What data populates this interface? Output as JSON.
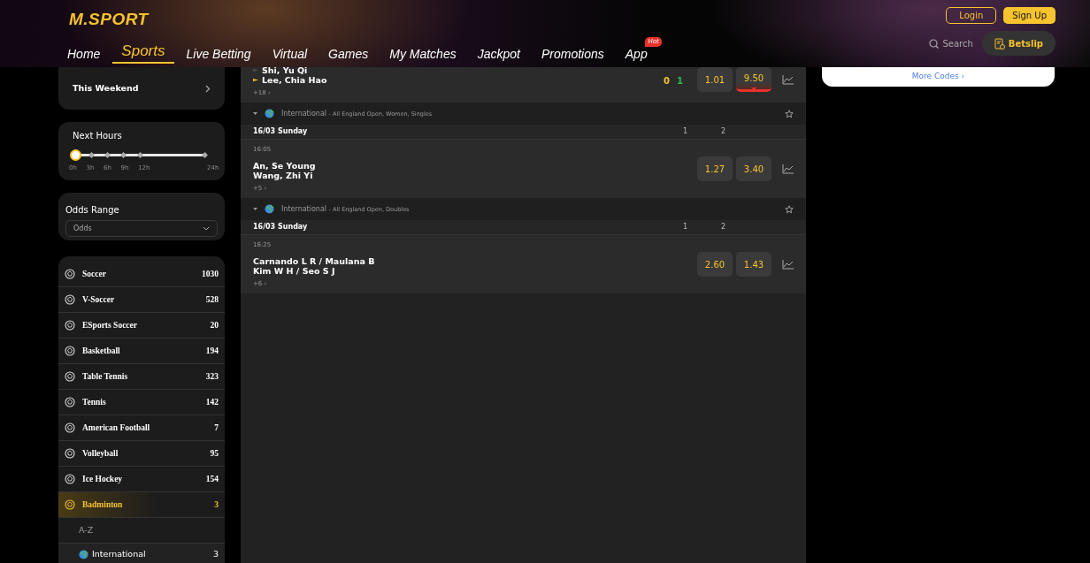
{
  "header": {
    "logo": "M.SPORT",
    "nav": [
      {
        "label": "Home",
        "selected": false
      },
      {
        "label": "Sports",
        "selected": true
      },
      {
        "label": "Live Betting",
        "selected": false
      },
      {
        "label": "Virtual",
        "selected": false
      },
      {
        "label": "Games",
        "selected": false
      },
      {
        "label": "My Matches",
        "selected": false
      },
      {
        "label": "Jackpot",
        "selected": false
      },
      {
        "label": "Promotions",
        "selected": false
      },
      {
        "label": "App",
        "selected": false,
        "badge": "Hot"
      }
    ],
    "login": "Login",
    "signup": "Sign Up",
    "search": "Search",
    "betslip": "Betslip"
  },
  "sidebar": {
    "this_weekend": "This Weekend",
    "next_hours": {
      "title": "Next Hours",
      "level": 0,
      "ticks": [
        "0h",
        "3h",
        "6h",
        "9h",
        "12h",
        "24h"
      ]
    },
    "odds_range": {
      "title": "Odds Range",
      "value": "Odds"
    },
    "sports": [
      {
        "name": "Soccer",
        "count": "1030",
        "selected": false
      },
      {
        "name": "V-Soccer",
        "count": "528",
        "selected": false
      },
      {
        "name": "ESports Soccer",
        "count": "20",
        "selected": false
      },
      {
        "name": "Basketball",
        "count": "194",
        "selected": false
      },
      {
        "name": "Table Tennis",
        "count": "323",
        "selected": false
      },
      {
        "name": "Tennis",
        "count": "142",
        "selected": false
      },
      {
        "name": "American Football",
        "count": "7",
        "selected": false
      },
      {
        "name": "Volleyball",
        "count": "95",
        "selected": false
      },
      {
        "name": "Ice Hockey",
        "count": "154",
        "selected": false
      },
      {
        "name": "Badminton",
        "count": "3",
        "selected": true
      }
    ],
    "sub_heading": "A-Z",
    "regions": [
      {
        "name": "International",
        "count": "3"
      }
    ]
  },
  "main": {
    "top_match": {
      "teams": [
        "Shi, Yu Qi",
        "Lee, Chia Hao"
      ],
      "scores": [
        "0",
        "1"
      ],
      "odds": [
        {
          "value": "1.01",
          "dropping": false
        },
        {
          "value": "9.50",
          "dropping": true
        }
      ],
      "more": "+18 ›"
    },
    "leagues": [
      {
        "region": "International",
        "name": "- All England Open, Women, Singles",
        "date": "16/03 Sunday",
        "columns": [
          "1",
          "2"
        ],
        "matches": [
          {
            "time": "16:05",
            "teams": [
              "An, Se Young",
              "Wang, Zhi Yi"
            ],
            "odds": [
              {
                "value": "1.27",
                "dropping": false
              },
              {
                "value": "3.40",
                "dropping": false
              }
            ],
            "more": "+5 ›"
          }
        ]
      },
      {
        "region": "International",
        "name": "- All England Open, Doubles",
        "date": "16/03 Sunday",
        "columns": [
          "1",
          "2"
        ],
        "matches": [
          {
            "time": "16:25",
            "teams": [
              "Carnando L R / Maulana B",
              "Kim W H / Seo S J"
            ],
            "odds": [
              {
                "value": "2.60",
                "dropping": false
              },
              {
                "value": "1.43",
                "dropping": false
              }
            ],
            "more": "+6 ›"
          }
        ]
      }
    ]
  },
  "right": {
    "more_codes": "More Codes ›"
  }
}
